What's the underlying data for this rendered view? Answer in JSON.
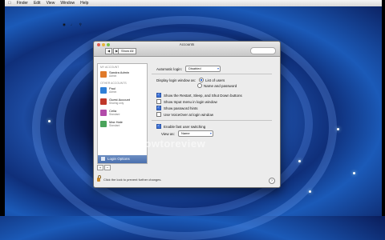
{
  "menubar": {
    "items": [
      "Finder",
      "Edit",
      "View",
      "Window",
      "Help"
    ]
  },
  "window": {
    "title": "Accounts",
    "nav_back": "◀",
    "nav_fwd": "▶",
    "show_all": "Show All"
  },
  "sidebar": {
    "my_account_header": "My Account",
    "my_account": {
      "name": "Sandra Admin",
      "sub": "Admin"
    },
    "other_header": "Other Accounts",
    "accounts": [
      {
        "name": "Paul",
        "sub": "Admin",
        "color": "#2f7fd6"
      },
      {
        "name": "Guest Account",
        "sub": "Sharing only",
        "color": "#c0392b"
      },
      {
        "name": "Celia",
        "sub": "Standard",
        "color": "#b24ca9"
      },
      {
        "name": "Max Hale",
        "sub": "Standard",
        "color": "#4aa35b"
      }
    ],
    "login_options": "Login Options",
    "add_btn": "+",
    "remove_btn": "−"
  },
  "panel": {
    "auto_login_label": "Automatic login:",
    "auto_login_value": "Disabled",
    "display_label": "Display login window as:",
    "radio_list": "List of users",
    "radio_name": "Name and password",
    "checks": [
      {
        "label": "Show the Restart, Sleep, and Shut Down buttons",
        "checked": true
      },
      {
        "label": "Show Input menu in login window",
        "checked": false
      },
      {
        "label": "Show password hints",
        "checked": true
      },
      {
        "label": "Use VoiceOver at login window",
        "checked": false
      }
    ],
    "fast_switch_label": "Enable fast user switching",
    "view_as_label": "View as:",
    "view_as_value": "Name",
    "watermark": "howtoreview"
  },
  "footer": {
    "lock_text": "Click the lock to prevent further changes.",
    "help": "?"
  }
}
